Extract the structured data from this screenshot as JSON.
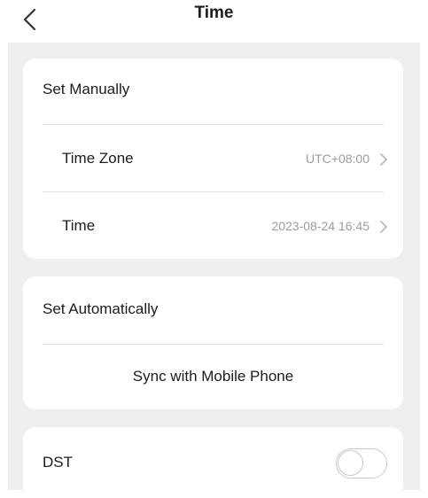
{
  "header": {
    "title": "Time",
    "back_icon": "chevron-left-icon"
  },
  "manual": {
    "section_title": "Set Manually",
    "time_zone": {
      "label": "Time Zone",
      "value": "UTC+08:00",
      "icon": "chevron-right-icon"
    },
    "time": {
      "label": "Time",
      "value": "2023-08-24 16:45",
      "icon": "chevron-right-icon"
    }
  },
  "automatic": {
    "section_title": "Set Automatically",
    "sync_label": "Sync with Mobile Phone"
  },
  "dst": {
    "label": "DST",
    "enabled": false
  },
  "colors": {
    "background": "#efeff2",
    "card": "#ffffff",
    "secondary_text": "#9b9ba1",
    "divider": "#e3e3e6"
  }
}
